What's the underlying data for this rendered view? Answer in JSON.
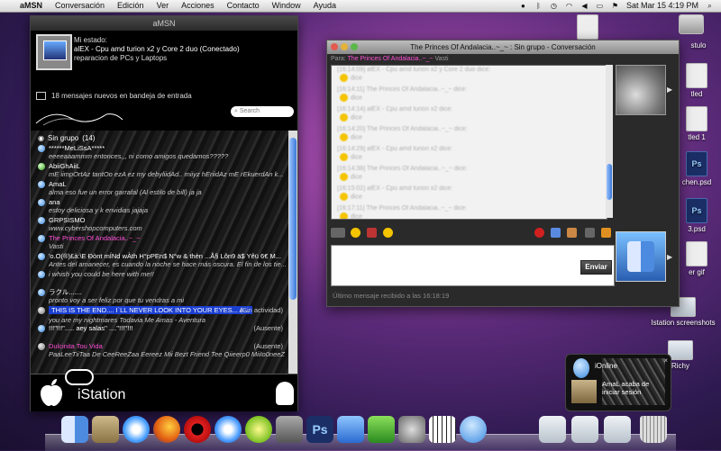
{
  "menubar": {
    "apple": "",
    "items": [
      "aMSN",
      "Conversación",
      "Edición",
      "Ver",
      "Acciones",
      "Contacto",
      "Window",
      "Ayuda"
    ],
    "clock": "Sat Mar 15  4:19 PM"
  },
  "desktop_icons": [
    {
      "label": ""
    },
    {
      "label": "stulo"
    },
    {
      "label": "tled"
    },
    {
      "label": "tled 1"
    },
    {
      "label": "chen.psd"
    },
    {
      "label": "3.psd"
    },
    {
      "label": "er gif"
    },
    {
      "label": "Istation screenshots"
    },
    {
      "label": "Richy"
    }
  ],
  "amsn": {
    "window_title": "aMSN",
    "status_label": "Mi estado:",
    "nick": "alEX -  Cpu amd turion x2 y Core 2 duo (Conectado)",
    "personal_msg": "reparacion de PCs y Laptops",
    "inbox": "18 mensajes nuevos en bandeja de entrada",
    "search_placeholder": "Search",
    "group": {
      "name": "Sin grupo",
      "count": "(14)"
    },
    "contacts": [
      {
        "name": "******MeLiSsA*****",
        "msg": "eeeeaaammm entonces,,, ni como amigos quedamos?????",
        "color": "white",
        "icon": "blue"
      },
      {
        "name": "AbiiGhAiiL",
        "msg": "mE iimpOrtAz tantOo ezA ez my debyliidAd.. miiyz hEriidAz mE rEkuerdAn k...",
        "color": "white",
        "icon": "green"
      },
      {
        "name": "AmaL",
        "msg": "alma eso fue un error garrafal (Al estilo  de bill) ja ja",
        "color": "white",
        "icon": "blue"
      },
      {
        "name": "ana",
        "msg": "estoy deliciosa y k envidias jajaja",
        "color": "white",
        "icon": "blue"
      },
      {
        "name": "GRPSISMO",
        "msg": "www.cybershopcomputers.com",
        "color": "white",
        "icon": "blue"
      },
      {
        "name": "The  Princes Of Andalacia..~_~",
        "msg": "Vasti",
        "color": "magenta",
        "icon": "blue"
      },
      {
        "name": "'o.O(®)£à:\\E Ðònt mÍNd wÀth H°pPEn$ N°w & thèn ...Å§ Lôn9 ä$ Yêü 6€ M...",
        "msg": "Antes del amanecer, es cuando la noche se hace más oscura. El fin de los tie...",
        "color": "white",
        "icon": "blue"
      },
      {
        "name": "",
        "msg": "i whish you could be here with me!!",
        "color": "white",
        "icon": "blue"
      },
      {
        "name": "ラクル.......",
        "msg": "pronto voy a ser feliz por que tu vendras a mi",
        "color": "white",
        "icon": "blue"
      },
      {
        "name": "THIS IS THE END....  I`LL NEVER LOOK INTO YOUR EYES...   A...",
        "tag": "(Sin actividad)",
        "msg": "you are my nightmares          Todavia Me Amas - Aventura",
        "color": "white",
        "icon": "grey",
        "selected": true
      },
      {
        "name": "!!!\"!!!\"..... aey salas'' ....''!!!''!!!",
        "tag": "(Ausente)",
        "msg": "",
        "color": "white",
        "icon": "blue"
      },
      {
        "name": "Dulcinita Tou Vida",
        "tag": "(Ausente)",
        "msg": "PaaLeeTiiTaa De CeeReeZaa Eereez Mii Bezt Friend Tee Qiieerp0 MiiIo0neeZ",
        "color": "magenta",
        "icon": "grey"
      }
    ],
    "footer_brand": "iStation"
  },
  "chat": {
    "window_title": "The  Princes Of Andalacia..~_~ : Sin grupo - Conversación",
    "to_label": "Para:",
    "to_name": "The  Princes Of Andalacia..~_~",
    "to_email": "Vasti",
    "history": [
      {
        "time": "[16:14:09]",
        "text": "alEX -  Cpu amd turion x2 y Core 2 duo dice:",
        "msg": "dice"
      },
      {
        "time": "[16:14:11]",
        "text": "The  Princes Of Andalacia..~_~ dice:",
        "msg": "dice"
      },
      {
        "time": "[16:14:14]",
        "text": "alEX -  Cpu amd turion x2 dice:",
        "msg": "dice"
      },
      {
        "time": "[16:14:20]",
        "text": "The  Princes Of Andalacia..~_~ dice:",
        "msg": "dice"
      },
      {
        "time": "[16:14:29]",
        "text": "alEX -  Cpu amd turion x2 dice:",
        "msg": "dice"
      },
      {
        "time": "[16:14:38]",
        "text": "The  Princes Of Andalacia..~_~ dice:",
        "msg": "dice"
      },
      {
        "time": "[16:15:02]",
        "text": "alEX -  Cpu amd turion x2 dice:",
        "msg": "dice"
      },
      {
        "time": "[16:17:11]",
        "text": "The  Princes Of Andalacia..~_~ dice:",
        "msg": "dice"
      }
    ],
    "send_label": "Enviar",
    "last_received": "Último mensaje recibido a las 16:18:19"
  },
  "notification": {
    "title": "iOnline",
    "text": "AmaL acaba de iniciar sesión"
  },
  "dock_icons": [
    "finder-icon",
    "mail-icon",
    "safari-icon",
    "firefox-icon",
    "opera-icon",
    "itunes-icon",
    "amsn-icon",
    "iphoto-icon",
    "photoshop-icon",
    "word-icon",
    "network-icon",
    "system-prefs-icon",
    "piano-icon",
    "ichat-icon",
    "folder-icon",
    "folder-icon",
    "folder-icon",
    "trash-icon"
  ]
}
